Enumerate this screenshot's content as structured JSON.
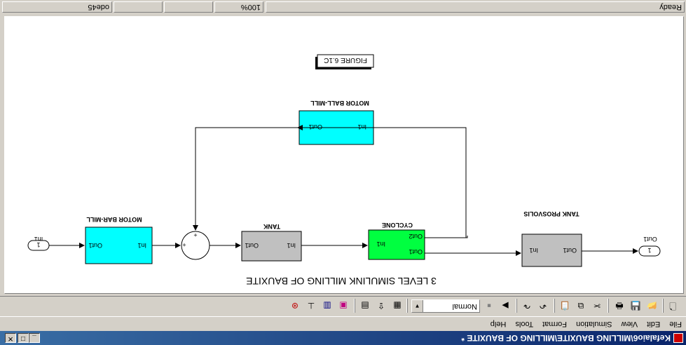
{
  "window": {
    "title": "Kefalaio6\\MILLING BAUXITE\\MILLING OF BAUXITE *",
    "buttons": {
      "minimize": "_",
      "maximize": "□",
      "close": "✕"
    }
  },
  "menu": {
    "items": [
      "File",
      "Edit",
      "View",
      "Simulation",
      "Format",
      "Tools",
      "Help"
    ]
  },
  "toolbar": {
    "sim_mode": "Normal"
  },
  "model": {
    "figure_label": "FIGURE 6.1C",
    "title": "3 LEVEL SIMULINK MILLING OF BAUXITE",
    "inport": {
      "label": "In1",
      "number": "1"
    },
    "outport": {
      "label": "Out1",
      "number": "1"
    },
    "motor_bar_mill": {
      "name": "MOTOR BAR-MILL",
      "in": "In1",
      "out": "Out1",
      "color": "#00ffff"
    },
    "sum": {
      "sign1": "+",
      "sign2": "+"
    },
    "tank": {
      "name": "TANK",
      "in": "In1",
      "out": "Out1",
      "color": "#c0c0c0"
    },
    "cyclone": {
      "name": "CYCLONE",
      "in": "In1",
      "out1": "Out1",
      "out2": "Out2",
      "color": "#00ff40"
    },
    "tank_prosvolis": {
      "name": "TANK PROSVOLIS",
      "in": "In1",
      "out": "Out1",
      "color": "#c0c0c0"
    },
    "motor_ball_mill": {
      "name": "MOTOR BALL-MILL",
      "in": "In1",
      "out": "Out1",
      "color": "#00ffff"
    }
  },
  "status": {
    "ready": "Ready",
    "zoom": "100%",
    "solver": "ode45"
  }
}
